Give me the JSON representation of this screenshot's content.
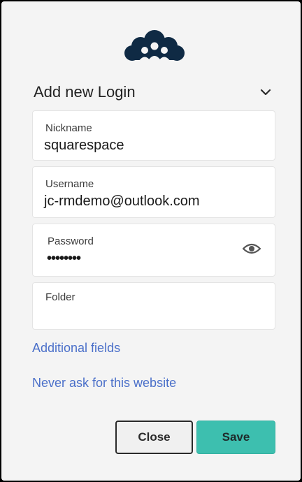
{
  "header": {
    "title": "Add new Login"
  },
  "fields": {
    "nickname": {
      "label": "Nickname",
      "value": "squarespace"
    },
    "username": {
      "label": "Username",
      "value": "jc-rmdemo@outlook.com"
    },
    "password": {
      "label": "Password",
      "value": "••••••••"
    },
    "folder": {
      "label": "Folder",
      "value": ""
    }
  },
  "links": {
    "additional_fields": "Additional fields",
    "never_ask": "Never ask for this website"
  },
  "buttons": {
    "close": "Close",
    "save": "Save"
  },
  "colors": {
    "logo": "#0f2a44",
    "link": "#4a6fc9",
    "save_bg": "#3dbfaf"
  },
  "icons": {
    "logo": "cloud-people-logo-icon",
    "chevron": "chevron-down-icon",
    "eye": "eye-icon"
  }
}
